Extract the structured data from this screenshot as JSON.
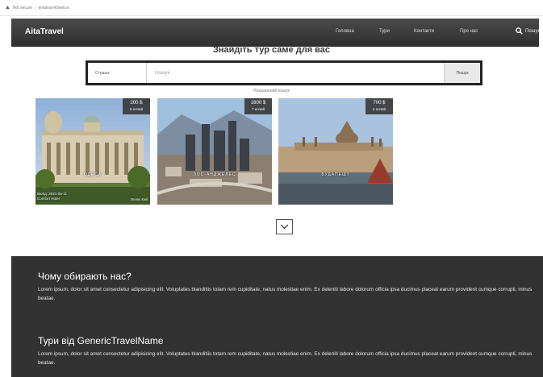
{
  "browser": {
    "security_label": "Not secure",
    "url": "emalrav.42web.io"
  },
  "header": {
    "logo": "AitaTravel",
    "nav": [
      "Головна",
      "Тури",
      "Контакти",
      "Про нас"
    ],
    "search_label": "Пошук"
  },
  "hero": {
    "title": "Знайдіть тур саме для вас"
  },
  "search": {
    "country_label": "Страна",
    "placeholder": "Пошук",
    "button_label": "Пошук",
    "advanced_link": "Розширений пошук"
  },
  "tours": [
    {
      "price": "200 $",
      "nights": "5 ночей",
      "city": "ОДЕСА",
      "date": "Вилід: 2021-05-11",
      "hotel": "Comfort Hotel",
      "city_from": "Велікі Кий"
    },
    {
      "price": "1600 $",
      "nights": "7 ночей",
      "city": "ЛОС-АНДЖЕЛЕС",
      "date": "",
      "hotel": "",
      "city_from": ""
    },
    {
      "price": "700 $",
      "nights": "4 ночей",
      "city": "БУДАПЕШТ",
      "date": "",
      "hotel": "",
      "city_from": ""
    }
  ],
  "sections": [
    {
      "title": "Чому обирають нас?",
      "text": "Lorem ipsum, dolor sit amet consectetur adipisicing elit. Voluptates blanditiis totam rem cupiditate, natus molestiae enim. Ex deleniti labore dolorum officia ipsa ducimus placeat earum provident cumque corrupti, minus beatae."
    },
    {
      "title": "Тури від GenericTravelName",
      "text": "Lorem ipsum, dolor sit amet consectetur adipisicing elit. Voluptates blanditiis totam rem cupiditate, natus molestiae enim. Ex deleniti labore dolorum officia ipsa ducimus placeat earum provident cumque corrupti, minus beatae."
    }
  ]
}
